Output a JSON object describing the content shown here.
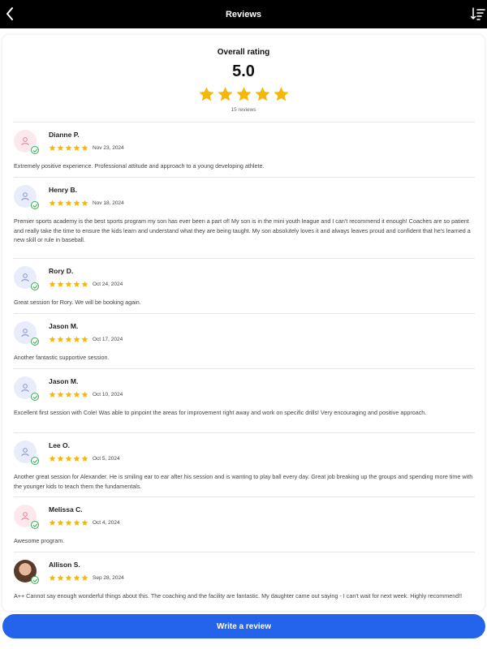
{
  "header": {
    "title": "Reviews",
    "back_icon": "chevron-left-icon",
    "sort_icon": "sort-descending-icon"
  },
  "summary": {
    "label": "Overall rating",
    "score": "5.0",
    "stars": 5,
    "count": "15 reviews"
  },
  "colors": {
    "star": "#f5b70a",
    "cta": "#2463eb",
    "verified": "#2bb34a",
    "header_bg": "#000000"
  },
  "reviews": [
    {
      "name": "Dianne P.",
      "date": "Nov 23, 2024",
      "rating": 5,
      "avatar": "pink",
      "text": "Extremely positive experience. Professional attitude and approach to a young developing athlete."
    },
    {
      "name": "Henry B.",
      "date": "Nov 18, 2024",
      "rating": 5,
      "avatar": "blue",
      "text": "Premier sports academy is the best sports program my son has ever been a part of! My son is in the mini youth league and I can't recommend it enough! Coaches are so patient and really take the time to ensure the kids learn and understand what they are being taught. My son absolutely loves it and always leaves proud and confident that he's learned a new skill or rule in baseball."
    },
    {
      "name": "Rory D.",
      "date": "Oct 24, 2024",
      "rating": 5,
      "avatar": "blue",
      "text": "Great session for Rory. We will be booking again."
    },
    {
      "name": "Jason M.",
      "date": "Oct 17, 2024",
      "rating": 5,
      "avatar": "blue",
      "text": "Another fantastic supportive session."
    },
    {
      "name": "Jason M.",
      "date": "Oct 10, 2024",
      "rating": 5,
      "avatar": "blue",
      "text": "Excellent first session with Cole! Was able to pinpoint the areas for improvement right away and work on specific drills! Very encouraging and positive approach."
    },
    {
      "name": "Lee O.",
      "date": "Oct 5, 2024",
      "rating": 5,
      "avatar": "blue",
      "text": "Another great session for Alexander. He is smiling ear to ear after his session and is wanting to play ball every day. Great job breaking up the groups and spending more time with the younger kids to teach them the fundamentals."
    },
    {
      "name": "Melissa C.",
      "date": "Oct 4, 2024",
      "rating": 5,
      "avatar": "pink",
      "text": "Awesome program."
    },
    {
      "name": "Allison S.",
      "date": "Sep 28, 2024",
      "rating": 5,
      "avatar": "photo",
      "text": "A++ Cannot say enough wonderful things about this. The coaching and the facility are fantastic. My daughter came out saying - I can't wait for next week. Highly recommend!!"
    }
  ],
  "cta": {
    "label": "Write a review"
  }
}
